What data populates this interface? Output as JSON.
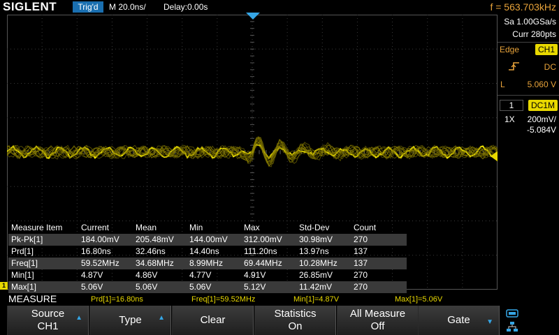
{
  "header": {
    "brand": "SIGLENT",
    "trigger_status": "Trig'd",
    "timebase": "M 20.0ns/",
    "delay": "Delay:0.00s",
    "frequency": "f = 563.703kHz"
  },
  "acquisition": {
    "sample_rate": "Sa 1.00GSa/s",
    "points": "Curr 280pts"
  },
  "trigger": {
    "type": "Edge",
    "source": "CH1",
    "coupling": "DC",
    "level_label": "L",
    "level_value": "5.060 V"
  },
  "channel": {
    "number": "1",
    "coupling": "DC1M",
    "probe": "1X",
    "volts_per_div": "200mV/",
    "offset": "-5.084V"
  },
  "measure_table": {
    "headers": [
      "Measure Item",
      "Current",
      "Mean",
      "Min",
      "Max",
      "Std-Dev",
      "Count"
    ],
    "rows": [
      [
        "Pk-Pk[1]",
        "184.00mV",
        "205.48mV",
        "144.00mV",
        "312.00mV",
        "30.98mV",
        "270"
      ],
      [
        "Prd[1]",
        "16.80ns",
        "32.46ns",
        "14.40ns",
        "111.20ns",
        "13.97ns",
        "137"
      ],
      [
        "Freq[1]",
        "59.52MHz",
        "34.68MHz",
        "8.99MHz",
        "69.44MHz",
        "10.28MHz",
        "137"
      ],
      [
        "Min[1]",
        "4.87V",
        "4.86V",
        "4.77V",
        "4.91V",
        "26.85mV",
        "270"
      ],
      [
        "Max[1]",
        "5.06V",
        "5.06V",
        "5.06V",
        "5.12V",
        "11.42mV",
        "270"
      ]
    ]
  },
  "measure_bar": {
    "title": "MEASURE",
    "summaries": [
      "Prd[1]=16.80ns",
      "Freq[1]=59.52MHz",
      "Min[1]=4.87V",
      "Max[1]=5.06V"
    ]
  },
  "softkeys": [
    {
      "line1": "Source",
      "line2": "CH1",
      "arrow": true
    },
    {
      "line1": "Type",
      "line2": "",
      "arrow": true
    },
    {
      "line1": "Clear",
      "line2": "",
      "arrow": false
    },
    {
      "line1": "Statistics",
      "line2": "On",
      "arrow": false
    },
    {
      "line1": "All Measure",
      "line2": "Off",
      "arrow": false
    },
    {
      "line1": "Gate",
      "line2": "",
      "arrow": true
    }
  ],
  "markers": {
    "channel_marker": "1"
  },
  "colors": {
    "channel1": "#e8d800",
    "accent_orange": "#e8a33a",
    "accent_blue": "#35a6e6",
    "trig_badge": "#1a6fb0"
  }
}
